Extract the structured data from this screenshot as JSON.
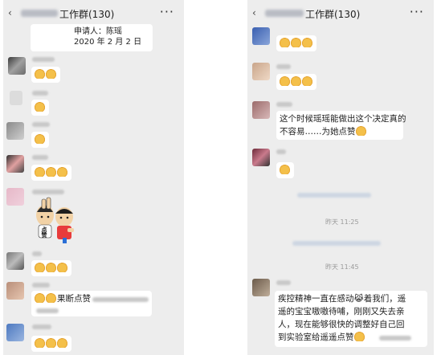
{
  "left_phone": {
    "title": "工作群(130)",
    "more": "···",
    "card": {
      "line1": "申请人：陈瑶",
      "line2": "2020 年 2 月 2 日"
    },
    "messages": [
      {
        "thumbs": 2,
        "text": ""
      },
      {
        "thumbs": 1,
        "text": ""
      },
      {
        "thumbs": 1,
        "text": ""
      },
      {
        "thumbs": 3,
        "text": ""
      },
      {
        "thumbs": 3,
        "text": ""
      },
      {
        "thumbs": 2,
        "text": "果断点赞"
      },
      {
        "thumbs": 3,
        "text": ""
      }
    ],
    "sticker_label": "点赞"
  },
  "right_phone": {
    "title": "工作群(130)",
    "more": "···",
    "messages": [
      {
        "thumbs": 3,
        "text": ""
      },
      {
        "thumbs": 3,
        "text": ""
      },
      {
        "thumbs": 1,
        "text_lines": [
          "这个时候瑶瑶能做出这个决定真的",
          "不容易……为她点赞"
        ]
      },
      {
        "thumbs": 1,
        "text": ""
      }
    ],
    "timestamp_1": "昨天 11:25",
    "timestamp_2": "昨天 11:45",
    "long_message": [
      "疾控精神一直在感动😹着我们，遥",
      "遥的宝宝嗷嗷待哺，刚刚又失去亲",
      "人，现在能够很快的调整好自己回",
      "到实验室给遥遥点赞"
    ]
  },
  "colors": {
    "chat_bg": "#ededed",
    "bubble": "#ffffff",
    "thumb": "#f4c04a"
  },
  "icons": [
    "back-icon",
    "more-icon",
    "thumbs-up-icon"
  ]
}
